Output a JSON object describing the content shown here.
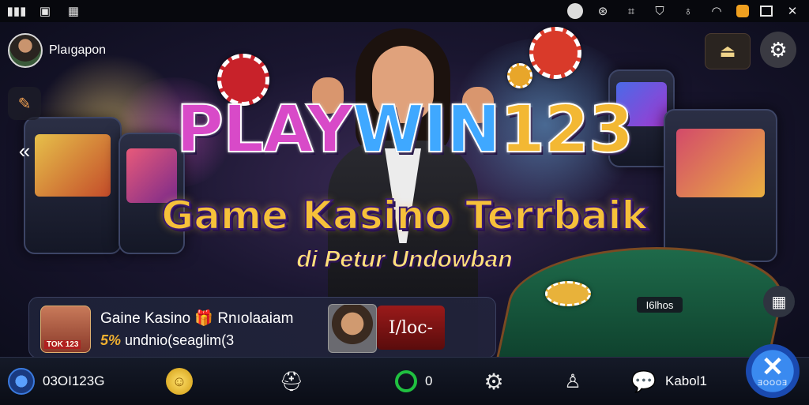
{
  "status_bar": {
    "left_icons": [
      "signal-bars-icon",
      "message-icon",
      "calendar-icon"
    ],
    "right_icons": [
      "record-dot-icon",
      "settings-circle-icon",
      "scan-icon",
      "shield-icon",
      "mic-icon",
      "wifi-icon",
      "battery-icon",
      "window-icon",
      "close-icon"
    ]
  },
  "profile": {
    "username": "Plaıgapon"
  },
  "hero": {
    "title_part1": "PLAY",
    "title_part2": "WIN",
    "title_part3": "123",
    "subtitle": "Game Kasino Terrbaik",
    "tagline": "di Petur Undowban"
  },
  "promo": {
    "thumb_tag": "TOK 123",
    "title": "Gaine Kasino",
    "title_extra": "Rnıolaaiam",
    "sub_pct": "5%",
    "sub_text": "undnio(seaglim(3",
    "cta_label": "I/loc-"
  },
  "floating_tag": "I6lhos",
  "bottom_bar": {
    "balance": "03OI123G",
    "ring_count": "0",
    "chat_label": "Kabol1"
  },
  "close_fab": {
    "label": "ƎOOOƎ"
  },
  "colors": {
    "accent_gold": "#f6c13a",
    "accent_blue": "#3a8af0",
    "close_ring": "#e0502a",
    "cta_red": "#9a1a1a",
    "ring_green": "#20c040"
  }
}
